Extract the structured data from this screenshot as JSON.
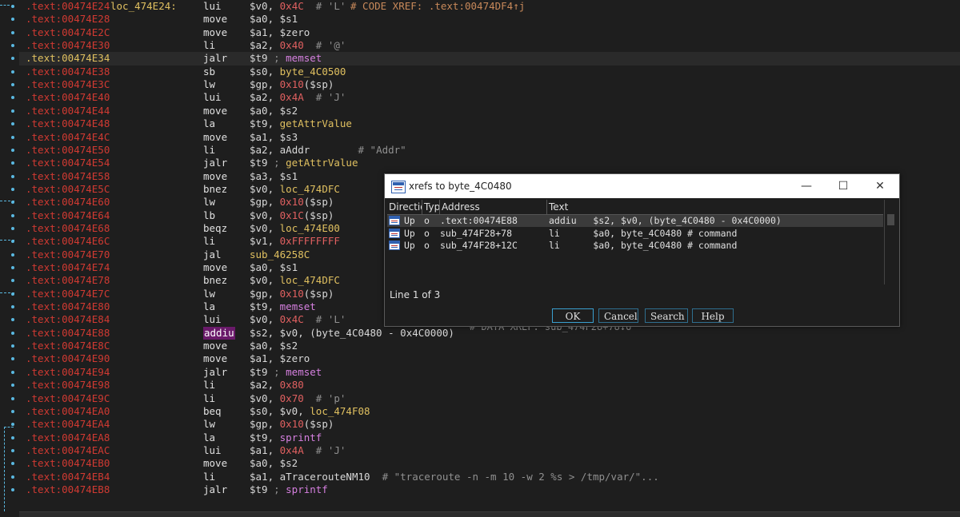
{
  "listing": {
    "rows": [
      {
        "addr": ".text:00474E24",
        "label": "loc_474E24:",
        "xref_comment": "# CODE XREF: .text:00474DF4↑j",
        "mn": "lui",
        "ops": [
          {
            "t": "$v0, ",
            "c": "reg"
          },
          {
            "t": "0x4C",
            "c": "num"
          },
          {
            "t": "  # 'L'",
            "c": "cmt"
          }
        ]
      },
      {
        "addr": ".text:00474E28",
        "mn": "move",
        "ops": [
          {
            "t": "$a0, $s1",
            "c": "reg"
          }
        ]
      },
      {
        "addr": ".text:00474E2C",
        "mn": "move",
        "ops": [
          {
            "t": "$a1, $zero",
            "c": "reg"
          }
        ]
      },
      {
        "addr": ".text:00474E30",
        "mn": "li",
        "ops": [
          {
            "t": "$a2, ",
            "c": "reg"
          },
          {
            "t": "0x40",
            "c": "num"
          },
          {
            "t": "  # '@'",
            "c": "cmt"
          }
        ]
      },
      {
        "addr": ".text:00474E34",
        "current": true,
        "mn": "jalr",
        "ops": [
          {
            "t": "$t9",
            "c": "reg"
          },
          {
            "t": " ; ",
            "c": "cmt"
          },
          {
            "t": "memset",
            "c": "func"
          }
        ]
      },
      {
        "addr": ".text:00474E38",
        "mn": "sb",
        "ops": [
          {
            "t": "$s0, ",
            "c": "reg"
          },
          {
            "t": "byte_4C0500",
            "c": "sym"
          }
        ]
      },
      {
        "addr": ".text:00474E3C",
        "mn": "lw",
        "ops": [
          {
            "t": "$gp, ",
            "c": "reg"
          },
          {
            "t": "0x10",
            "c": "num"
          },
          {
            "t": "($sp)",
            "c": "reg"
          }
        ]
      },
      {
        "addr": ".text:00474E40",
        "mn": "lui",
        "ops": [
          {
            "t": "$a2, ",
            "c": "reg"
          },
          {
            "t": "0x4A",
            "c": "num"
          },
          {
            "t": "  # 'J'",
            "c": "cmt"
          }
        ]
      },
      {
        "addr": ".text:00474E44",
        "mn": "move",
        "ops": [
          {
            "t": "$a0, $s2",
            "c": "reg"
          }
        ]
      },
      {
        "addr": ".text:00474E48",
        "mn": "la",
        "ops": [
          {
            "t": "$t9, ",
            "c": "reg"
          },
          {
            "t": "getAttrValue",
            "c": "sym"
          }
        ]
      },
      {
        "addr": ".text:00474E4C",
        "mn": "move",
        "ops": [
          {
            "t": "$a1, $s3",
            "c": "reg"
          }
        ]
      },
      {
        "addr": ".text:00474E50",
        "mn": "li",
        "ops": [
          {
            "t": "$a2, ",
            "c": "reg"
          },
          {
            "t": "aAddr",
            "c": "reg"
          },
          {
            "t": "        # \"Addr\"",
            "c": "cmt"
          }
        ]
      },
      {
        "addr": ".text:00474E54",
        "mn": "jalr",
        "ops": [
          {
            "t": "$t9",
            "c": "reg"
          },
          {
            "t": " ; ",
            "c": "cmt"
          },
          {
            "t": "getAttrValue",
            "c": "sym"
          }
        ]
      },
      {
        "addr": ".text:00474E58",
        "mn": "move",
        "ops": [
          {
            "t": "$a3, $s1",
            "c": "reg"
          }
        ]
      },
      {
        "addr": ".text:00474E5C",
        "mn": "bnez",
        "ops": [
          {
            "t": "$v0, ",
            "c": "reg"
          },
          {
            "t": "loc_474DFC",
            "c": "sym"
          }
        ]
      },
      {
        "addr": ".text:00474E60",
        "mn": "lw",
        "ops": [
          {
            "t": "$gp, ",
            "c": "reg"
          },
          {
            "t": "0x10",
            "c": "num"
          },
          {
            "t": "($sp)",
            "c": "reg"
          }
        ]
      },
      {
        "addr": ".text:00474E64",
        "mn": "lb",
        "ops": [
          {
            "t": "$v0, ",
            "c": "reg"
          },
          {
            "t": "0x1C",
            "c": "num"
          },
          {
            "t": "($sp)",
            "c": "reg"
          }
        ]
      },
      {
        "addr": ".text:00474E68",
        "mn": "beqz",
        "ops": [
          {
            "t": "$v0, ",
            "c": "reg"
          },
          {
            "t": "loc_474E00",
            "c": "sym"
          }
        ]
      },
      {
        "addr": ".text:00474E6C",
        "mn": "li",
        "ops": [
          {
            "t": "$v1, ",
            "c": "reg"
          },
          {
            "t": "0xFFFFFFFF",
            "c": "num"
          }
        ]
      },
      {
        "addr": ".text:00474E70",
        "mn": "jal",
        "ops": [
          {
            "t": "sub_46258C",
            "c": "sym"
          }
        ]
      },
      {
        "addr": ".text:00474E74",
        "mn": "move",
        "ops": [
          {
            "t": "$a0, $s1",
            "c": "reg"
          }
        ]
      },
      {
        "addr": ".text:00474E78",
        "mn": "bnez",
        "ops": [
          {
            "t": "$v0, ",
            "c": "reg"
          },
          {
            "t": "loc_474DFC",
            "c": "sym"
          }
        ]
      },
      {
        "addr": ".text:00474E7C",
        "mn": "lw",
        "ops": [
          {
            "t": "$gp, ",
            "c": "reg"
          },
          {
            "t": "0x10",
            "c": "num"
          },
          {
            "t": "($sp)",
            "c": "reg"
          }
        ]
      },
      {
        "addr": ".text:00474E80",
        "mn": "la",
        "ops": [
          {
            "t": "$t9, ",
            "c": "reg"
          },
          {
            "t": "memset",
            "c": "func"
          }
        ]
      },
      {
        "addr": ".text:00474E84",
        "mn": "lui",
        "ops": [
          {
            "t": "$v0, ",
            "c": "reg"
          },
          {
            "t": "0x4C",
            "c": "num"
          },
          {
            "t": "  # 'L'",
            "c": "cmt"
          }
        ]
      },
      {
        "addr": ".text:00474E88",
        "mn": "addiu",
        "highlight": true,
        "ops": [
          {
            "t": "$s2, $v0, (",
            "c": "reg"
          },
          {
            "t": "byte_4C0480",
            "c": "reg"
          },
          {
            "t": " - ",
            "c": "reg"
          },
          {
            "t": "0x4C0000",
            "c": "reg"
          },
          {
            "t": ")",
            "c": "reg"
          }
        ]
      },
      {
        "addr": ".text:00474E8C",
        "mn": "move",
        "ops": [
          {
            "t": "$a0, $s2",
            "c": "reg"
          }
        ]
      },
      {
        "addr": ".text:00474E90",
        "mn": "move",
        "ops": [
          {
            "t": "$a1, $zero",
            "c": "reg"
          }
        ]
      },
      {
        "addr": ".text:00474E94",
        "mn": "jalr",
        "ops": [
          {
            "t": "$t9",
            "c": "reg"
          },
          {
            "t": " ; ",
            "c": "cmt"
          },
          {
            "t": "memset",
            "c": "func"
          }
        ]
      },
      {
        "addr": ".text:00474E98",
        "mn": "li",
        "ops": [
          {
            "t": "$a2, ",
            "c": "reg"
          },
          {
            "t": "0x80",
            "c": "num"
          }
        ]
      },
      {
        "addr": ".text:00474E9C",
        "mn": "li",
        "ops": [
          {
            "t": "$v0, ",
            "c": "reg"
          },
          {
            "t": "0x70",
            "c": "num"
          },
          {
            "t": "  # 'p'",
            "c": "cmt"
          }
        ]
      },
      {
        "addr": ".text:00474EA0",
        "mn": "beq",
        "ops": [
          {
            "t": "$s0, $v0, ",
            "c": "reg"
          },
          {
            "t": "loc_474F08",
            "c": "sym"
          }
        ]
      },
      {
        "addr": ".text:00474EA4",
        "mn": "lw",
        "ops": [
          {
            "t": "$gp, ",
            "c": "reg"
          },
          {
            "t": "0x10",
            "c": "num"
          },
          {
            "t": "($sp)",
            "c": "reg"
          }
        ]
      },
      {
        "addr": ".text:00474EA8",
        "mn": "la",
        "ops": [
          {
            "t": "$t9, ",
            "c": "reg"
          },
          {
            "t": "sprintf",
            "c": "func"
          }
        ]
      },
      {
        "addr": ".text:00474EAC",
        "mn": "lui",
        "ops": [
          {
            "t": "$a1, ",
            "c": "reg"
          },
          {
            "t": "0x4A",
            "c": "num"
          },
          {
            "t": "  # 'J'",
            "c": "cmt"
          }
        ]
      },
      {
        "addr": ".text:00474EB0",
        "mn": "move",
        "ops": [
          {
            "t": "$a0, $s2",
            "c": "reg"
          }
        ]
      },
      {
        "addr": ".text:00474EB4",
        "mn": "li",
        "ops": [
          {
            "t": "$a1, ",
            "c": "reg"
          },
          {
            "t": "aTracerouteNM10",
            "c": "reg"
          },
          {
            "t": "  # \"traceroute -n -m 10 -w 2 %s > /tmp/var/\"...",
            "c": "cmt"
          }
        ]
      },
      {
        "addr": ".text:00474EB8",
        "mn": "jalr",
        "ops": [
          {
            "t": "$t9",
            "c": "reg"
          },
          {
            "t": " ; ",
            "c": "cmt"
          },
          {
            "t": "sprintf",
            "c": "func"
          }
        ]
      }
    ]
  },
  "behind_text": "# DATA XREF: sub_474F28+78↓o",
  "dialog": {
    "title": "xrefs to byte_4C0480",
    "minimize": "—",
    "maximize": "☐",
    "close": "✕",
    "columns": [
      "Directio",
      "Typ",
      "Address",
      "Text"
    ],
    "rows": [
      {
        "dir": "Up",
        "type": "o",
        "address": ".text:00474E88",
        "text": "addiu   $s2, $v0, (byte_4C0480 - 0x4C0000)"
      },
      {
        "dir": "Up",
        "type": "o",
        "address": "sub_474F28+78",
        "text": "li      $a0, byte_4C0480 # command"
      },
      {
        "dir": "Up",
        "type": "o",
        "address": "sub_474F28+12C",
        "text": "li      $a0, byte_4C0480 # command"
      }
    ],
    "status": "Line 1 of 3",
    "buttons": {
      "ok": "OK",
      "cancel": "Cancel",
      "search": "Search",
      "help": "Help"
    }
  }
}
